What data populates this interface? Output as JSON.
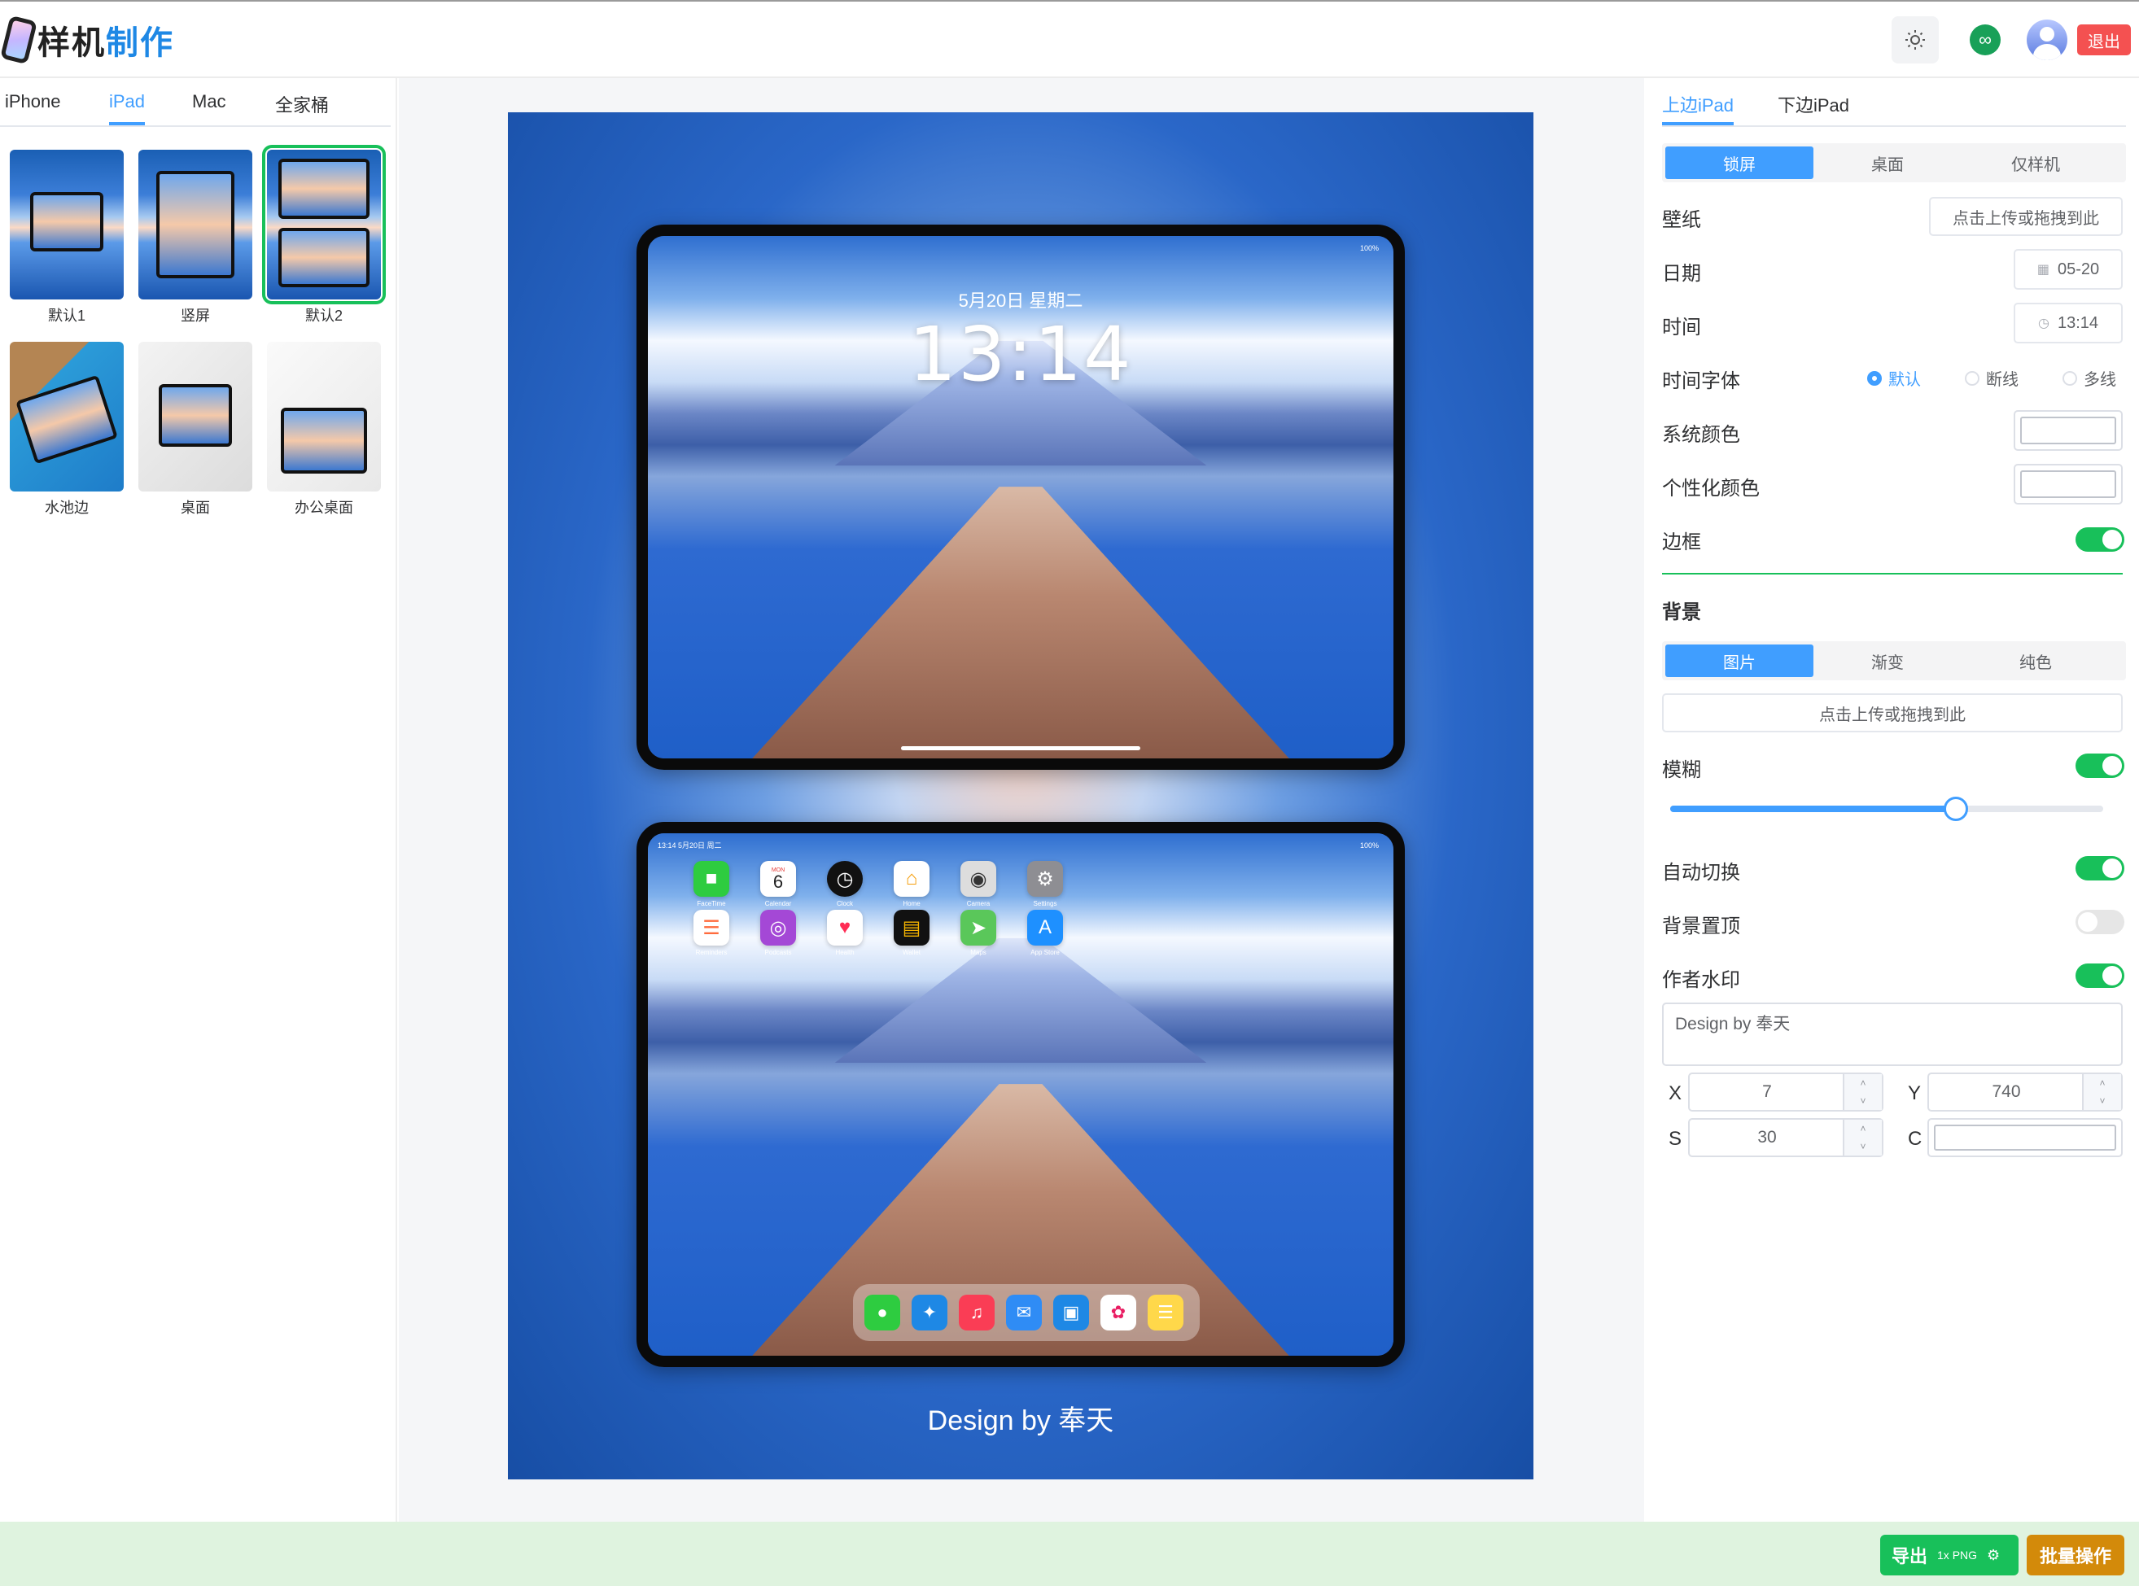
{
  "header": {
    "logo_text_1": "样机",
    "logo_text_2": "制作",
    "theme_icon": "sun-icon",
    "link_icon": "link-icon",
    "logout_label": "退出"
  },
  "device_tabs": [
    "iPhone",
    "iPad",
    "Mac",
    "全家桶"
  ],
  "device_tab_active": "iPad",
  "templates": [
    {
      "label": "默认1"
    },
    {
      "label": "竖屏"
    },
    {
      "label": "默认2",
      "selected": true
    },
    {
      "label": "水池边"
    },
    {
      "label": "桌面"
    },
    {
      "label": "办公桌面"
    }
  ],
  "preview": {
    "lock_date": "5月20日 星期二",
    "lock_time": "13:14",
    "status_right": "100%",
    "home_status": "13:14 5月20日 周二",
    "apps_row1": [
      {
        "icon": "facetime-icon",
        "label": "FaceTime",
        "color": "#2ecc40"
      },
      {
        "icon": "calendar-icon",
        "label": "Calendar",
        "color": "#ffffff"
      },
      {
        "icon": "clock-icon",
        "label": "Clock",
        "color": "#111111"
      },
      {
        "icon": "home-icon",
        "label": "Home",
        "color": "#ffffff"
      },
      {
        "icon": "camera-icon",
        "label": "Camera",
        "color": "#dddddd"
      },
      {
        "icon": "settings-icon",
        "label": "Settings",
        "color": "#8e8e93"
      }
    ],
    "apps_row2": [
      {
        "icon": "reminders-icon",
        "label": "Reminders",
        "color": "#ffffff"
      },
      {
        "icon": "podcasts-icon",
        "label": "Podcasts",
        "color": "#a448d6"
      },
      {
        "icon": "health-icon",
        "label": "Health",
        "color": "#ffffff"
      },
      {
        "icon": "wallet-icon",
        "label": "Wallet",
        "color": "#111111"
      },
      {
        "icon": "maps-icon",
        "label": "Maps",
        "color": "#5ac75a"
      },
      {
        "icon": "appstore-icon",
        "label": "App Store",
        "color": "#1e90ff"
      }
    ],
    "calendar_day": "MON",
    "calendar_num": "6",
    "dock": [
      {
        "icon": "messages-icon",
        "color": "#2ecc40"
      },
      {
        "icon": "safari-icon",
        "color": "#1e88e5"
      },
      {
        "icon": "music-icon",
        "color": "#fa3d55"
      },
      {
        "icon": "mail-icon",
        "color": "#2f8cf5"
      },
      {
        "icon": "files-icon",
        "color": "#1e88e5"
      },
      {
        "icon": "photos-icon",
        "color": "#ffffff"
      },
      {
        "icon": "notes-icon",
        "color": "#ffd84a"
      }
    ],
    "watermark": "Design by 奉天"
  },
  "settings": {
    "tabs": [
      "上边iPad",
      "下边iPad"
    ],
    "tab_active": "上边iPad",
    "mode_options": [
      "锁屏",
      "桌面",
      "仅样机"
    ],
    "mode_active": "锁屏",
    "wallpaper_label": "壁纸",
    "upload_text": "点击上传或拖拽到此",
    "date_label": "日期",
    "date_value": "05-20",
    "time_label": "时间",
    "time_value": "13:14",
    "font_label": "时间字体",
    "font_options": [
      "默认",
      "断线",
      "多线"
    ],
    "font_active": "默认",
    "sys_color_label": "系统颜色",
    "custom_color_label": "个性化颜色",
    "border_label": "边框",
    "border_on": true
  },
  "background": {
    "title": "背景",
    "type_options": [
      "图片",
      "渐变",
      "纯色"
    ],
    "type_active": "图片",
    "upload_text": "点击上传或拖拽到此",
    "blur_label": "模糊",
    "blur_on": true,
    "blur_level": 0.66,
    "auto_switch_label": "自动切换",
    "auto_switch_on": true,
    "bg_top_label": "背景置顶",
    "bg_top_on": false,
    "watermark_label": "作者水印",
    "watermark_on": true,
    "watermark_text": "Design by 奉天",
    "x_label": "X",
    "x_value": "7",
    "y_label": "Y",
    "y_value": "740",
    "s_label": "S",
    "s_value": "30",
    "c_label": "C"
  },
  "footer": {
    "export_label": "导出",
    "export_format": "1x PNG",
    "export_gear_icon": "gear-icon",
    "batch_label": "批量操作"
  }
}
